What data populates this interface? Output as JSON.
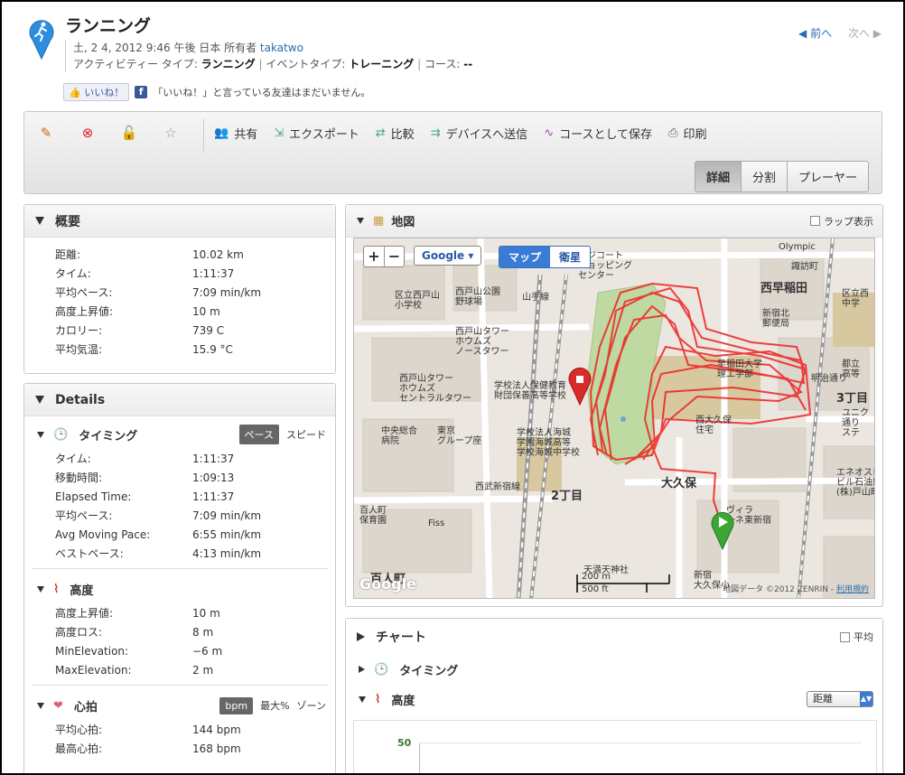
{
  "activity": {
    "title": "ランニング",
    "date_line_prefix": "土, 2 4, 2012 9:46 午後 日本 所有者",
    "owner": "takatwo",
    "activity_type_label": "アクティビティー タイプ:",
    "activity_type": "ランニング",
    "event_type_label": "イベントタイプ:",
    "event_type": "トレーニング",
    "course_label": "コース:",
    "course": "--",
    "prev": "前へ",
    "next": "次へ",
    "like_button": "いいね！",
    "like_text": "「いいね！」と言っている友達はまだいません。"
  },
  "toolbar": {
    "actions": [
      "共有",
      "エクスポート",
      "比較",
      "デバイスへ送信",
      "コースとして保存",
      "印刷"
    ],
    "views": [
      "詳細",
      "分割",
      "プレーヤー"
    ]
  },
  "summary": {
    "title": "概要",
    "rows": [
      {
        "k": "距離:",
        "v": "10.02 km"
      },
      {
        "k": "タイム:",
        "v": "1:11:37"
      },
      {
        "k": "平均ペース:",
        "v": "7:09 min/km"
      },
      {
        "k": "高度上昇値:",
        "v": "10 m"
      },
      {
        "k": "カロリー:",
        "v": "739 C"
      },
      {
        "k": "平均気温:",
        "v": "15.9 °C"
      }
    ]
  },
  "details": {
    "title": "Details",
    "timing": {
      "title": "タイミング",
      "toggle": [
        "ペース",
        "スピード"
      ],
      "rows": [
        {
          "k": "タイム:",
          "v": "1:11:37"
        },
        {
          "k": "移動時間:",
          "v": "1:09:13"
        },
        {
          "k": "Elapsed Time:",
          "v": "1:11:37"
        },
        {
          "k": "平均ペース:",
          "v": "7:09 min/km"
        },
        {
          "k": "Avg Moving Pace:",
          "v": "6:55 min/km"
        },
        {
          "k": "ベストペース:",
          "v": "4:13 min/km"
        }
      ]
    },
    "elevation": {
      "title": "高度",
      "rows": [
        {
          "k": "高度上昇値:",
          "v": "10 m"
        },
        {
          "k": "高度ロス:",
          "v": "8 m"
        },
        {
          "k": "MinElevation:",
          "v": "−6 m"
        },
        {
          "k": "MaxElevation:",
          "v": "2 m"
        }
      ]
    },
    "heart": {
      "title": "心拍",
      "toggle": [
        "bpm",
        "最大%",
        "ゾーン"
      ],
      "rows": [
        {
          "k": "平均心拍:",
          "v": "144 bpm"
        },
        {
          "k": "最高心拍:",
          "v": "168 bpm"
        }
      ]
    }
  },
  "map": {
    "title": "地図",
    "lap_toggle": "ラップ表示",
    "provider": "Google",
    "types": [
      "マップ",
      "衛星"
    ],
    "scale_m": "200 m",
    "scale_ft": "500 ft",
    "copyright": "地図データ ©2012 ZENRIN -",
    "terms": "利用規約",
    "logo": "Google",
    "labels": {
      "l1": "区立西戸山\n小学校",
      "l2": "西戸山公園\n野球場",
      "l3": "西戸山タワー\nホウムズ\nノースタワー",
      "l4": "西戸山タワー\nホウムズ\nセントラルタワー",
      "l5": "学校法人保健教育\n財団保善高等学校",
      "l6": "中央総合\n病院",
      "l7": "東京\nグループ座",
      "l8": "学校法人海城\n学園海城高等\n学校海城中学校",
      "l9": "西早稲田",
      "l10": "大久保",
      "l11": "2丁目",
      "l12": "3丁目",
      "l13": "百人町\n保育園",
      "l14": "ヴィラ\n一ネ東新宿",
      "l15": "西大久保\n住宅",
      "l16": "諏訪町",
      "l17": "新宿北\n郵便局",
      "l18": "早稲田大学\n理工学部",
      "l19": "山手線",
      "l20": "西武新宿線",
      "l21": "Olympic",
      "l22": "エネオス日\nビル石油販\n(株)戸山町",
      "l23": "ユニク\n通り\nステ",
      "l24": "都立\n高等",
      "l25": "区立西\n中学",
      "l26": "百人町",
      "l27": "Fiss",
      "l28": "天満天神社",
      "l29": "新宿\n大久保小",
      "l30": "明治通り",
      "l31": "ンジコート\nショッピング\nセンター"
    }
  },
  "chart": {
    "title": "チャート",
    "avg_toggle": "平均",
    "timing": "タイミング",
    "elevation": "高度",
    "axis_select": "距離",
    "y_tick": "50"
  }
}
